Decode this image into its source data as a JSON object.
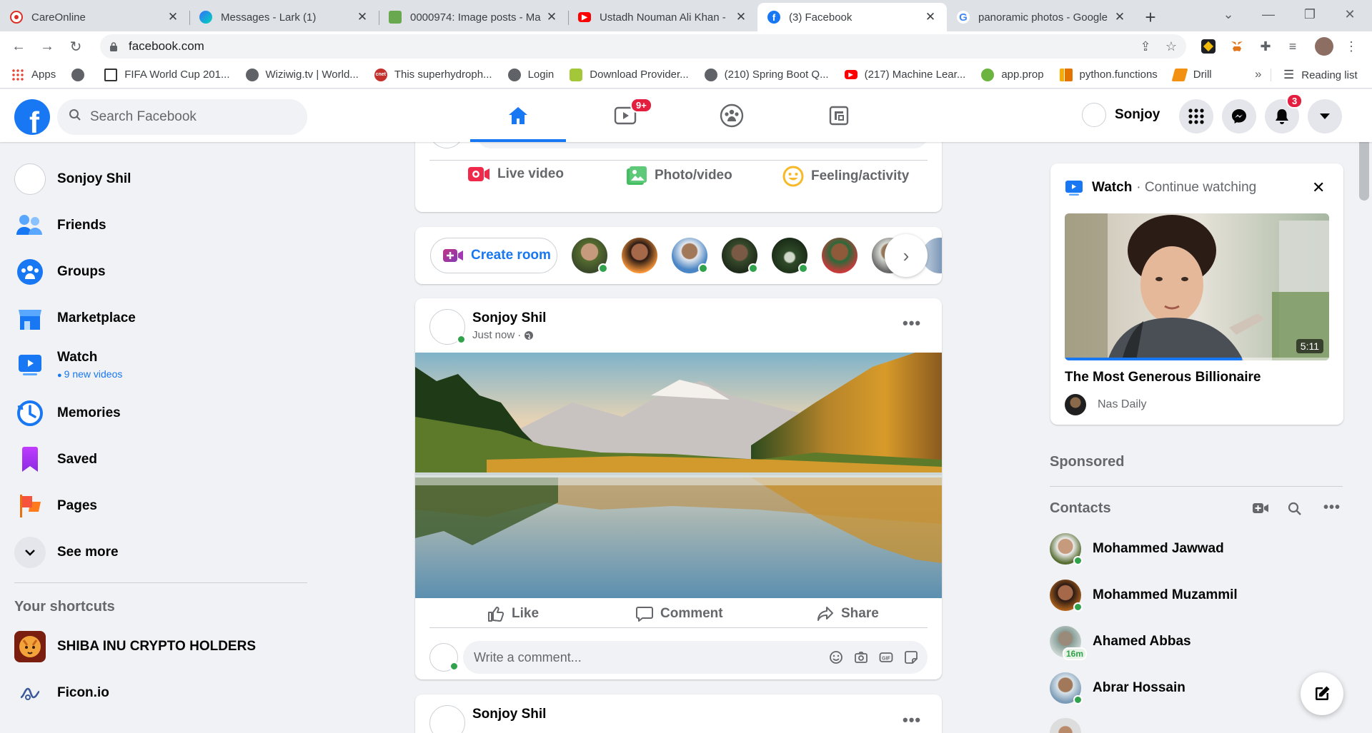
{
  "browser": {
    "tabs": [
      {
        "title": "CareOnline",
        "active": false
      },
      {
        "title": "Messages - Lark (1)",
        "active": false
      },
      {
        "title": "0000974: Image posts - Ma",
        "active": false
      },
      {
        "title": "Ustadh Nouman Ali Khan -",
        "active": false
      },
      {
        "title": "(3) Facebook",
        "active": true
      },
      {
        "title": "panoramic photos - Google",
        "active": false
      }
    ],
    "url": "facebook.com",
    "bookmarks": [
      {
        "label": "Apps"
      },
      {
        "label": ""
      },
      {
        "label": "FIFA World Cup 201..."
      },
      {
        "label": "Wiziwig.tv | World..."
      },
      {
        "label": "This superhydroph..."
      },
      {
        "label": "Login"
      },
      {
        "label": "Download Provider..."
      },
      {
        "label": "(210) Spring Boot Q..."
      },
      {
        "label": "(217) Machine Lear..."
      },
      {
        "label": "app.prop"
      },
      {
        "label": "python.functions"
      },
      {
        "label": "Drill"
      }
    ],
    "bookmarks_overflow": "»",
    "reading_list": "Reading list"
  },
  "fb": {
    "logo": "f",
    "search_placeholder": "Search Facebook",
    "watch_badge": "9+",
    "notif_badge": "3",
    "user_short": "Sonjoy"
  },
  "left": {
    "items": [
      {
        "label": "Sonjoy Shil",
        "icon": "avatar"
      },
      {
        "label": "Friends",
        "icon": "friends-icon"
      },
      {
        "label": "Groups",
        "icon": "groups-icon"
      },
      {
        "label": "Marketplace",
        "icon": "marketplace-icon"
      },
      {
        "label": "Watch",
        "icon": "watch-icon",
        "sub": "9 new videos"
      },
      {
        "label": "Memories",
        "icon": "memories-icon"
      },
      {
        "label": "Saved",
        "icon": "saved-icon"
      },
      {
        "label": "Pages",
        "icon": "pages-icon"
      },
      {
        "label": "See more",
        "icon": "chevron-down-icon"
      }
    ],
    "shortcuts_title": "Your shortcuts",
    "shortcuts": [
      {
        "label": "SHIBA INU CRYPTO HOLDERS"
      },
      {
        "label": "Ficon.io"
      }
    ]
  },
  "feed": {
    "composer_actions": [
      {
        "label": "Live video",
        "color": "#f02849"
      },
      {
        "label": "Photo/video",
        "color": "#45bd62"
      },
      {
        "label": "Feeling/activity",
        "color": "#f7b928"
      }
    ],
    "create_room": "Create room",
    "posts": [
      {
        "author": "Sonjoy Shil",
        "time": "Just now"
      },
      {
        "author": "Sonjoy Shil"
      }
    ],
    "actions": {
      "like": "Like",
      "comment": "Comment",
      "share": "Share"
    },
    "comment_placeholder": "Write a comment..."
  },
  "right": {
    "watch_title": "Watch",
    "watch_sub": "· Continue watching",
    "video_duration": "5:11",
    "video_progress": 0.67,
    "video_title": "The Most Generous Billionaire",
    "channel": "Nas Daily",
    "sponsored": "Sponsored",
    "contacts_title": "Contacts",
    "contacts": [
      {
        "name": "Mohammed Jawwad",
        "online": true
      },
      {
        "name": "Mohammed Muzammil",
        "online": true
      },
      {
        "name": "Ahamed Abbas",
        "online": false,
        "last_active": "16m"
      },
      {
        "name": "Abrar Hossain",
        "online": true
      }
    ]
  }
}
